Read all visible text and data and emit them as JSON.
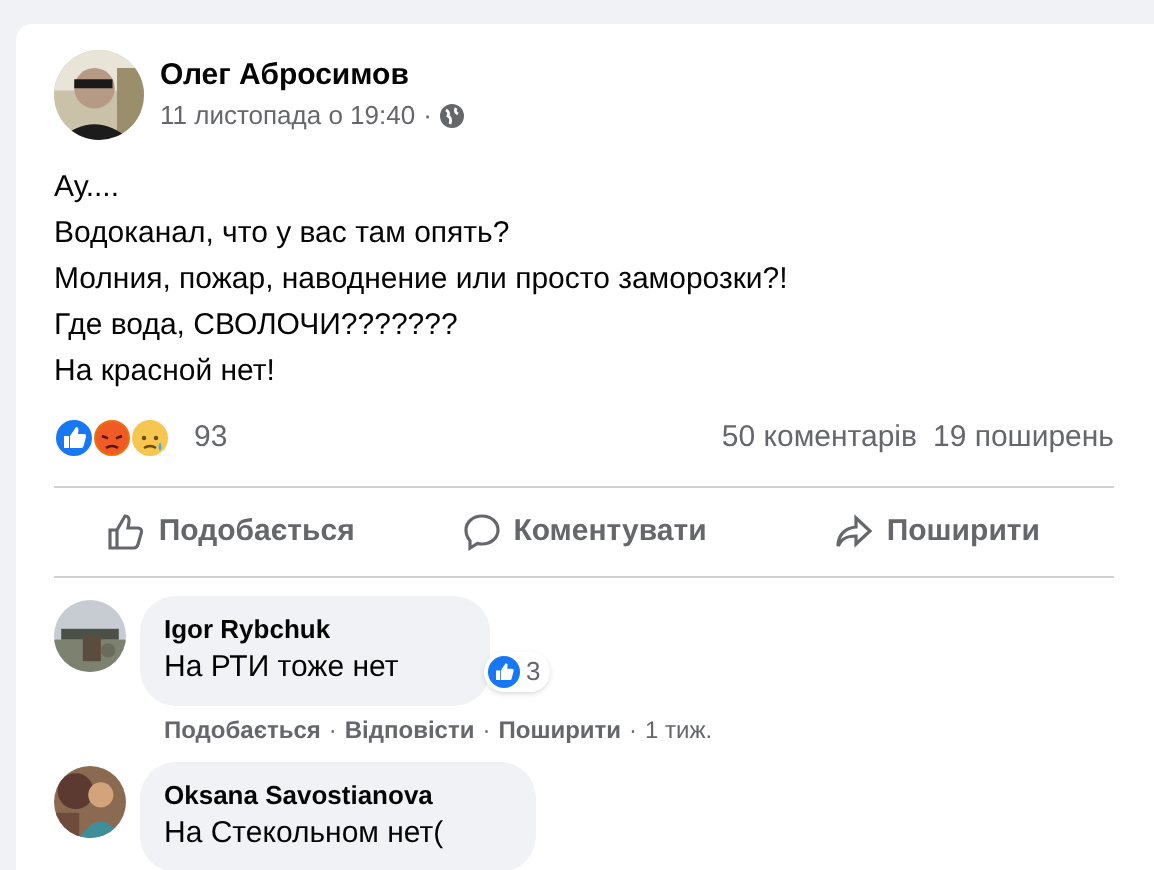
{
  "post": {
    "author": "Олег Абросимов",
    "timestamp": "11 листопада о 19:40",
    "separator": "·",
    "text_lines": [
      "Ау....",
      "Водоканал, что у вас там опять?",
      "Молния, пожар, наводнение или просто заморозки?!",
      "Где вода, СВОЛОЧИ???????",
      "На красной нет!"
    ]
  },
  "reactions": {
    "count": "93",
    "comments": "50 коментарів",
    "shares": "19 поширень"
  },
  "actions": [
    {
      "kind": "like",
      "label": "Подобається"
    },
    {
      "kind": "comment",
      "label": "Коментувати"
    },
    {
      "kind": "share",
      "label": "Поширити"
    }
  ],
  "comments": [
    {
      "author": "Igor Rybchuk",
      "text": "На РТИ тоже нет",
      "like_count": "3",
      "links": [
        "Подобається",
        "Відповісти",
        "Поширити"
      ],
      "separator": "·",
      "time": "1 тиж."
    },
    {
      "author": "Oksana Savostianova",
      "text": "На Стекольном нет("
    }
  ]
}
